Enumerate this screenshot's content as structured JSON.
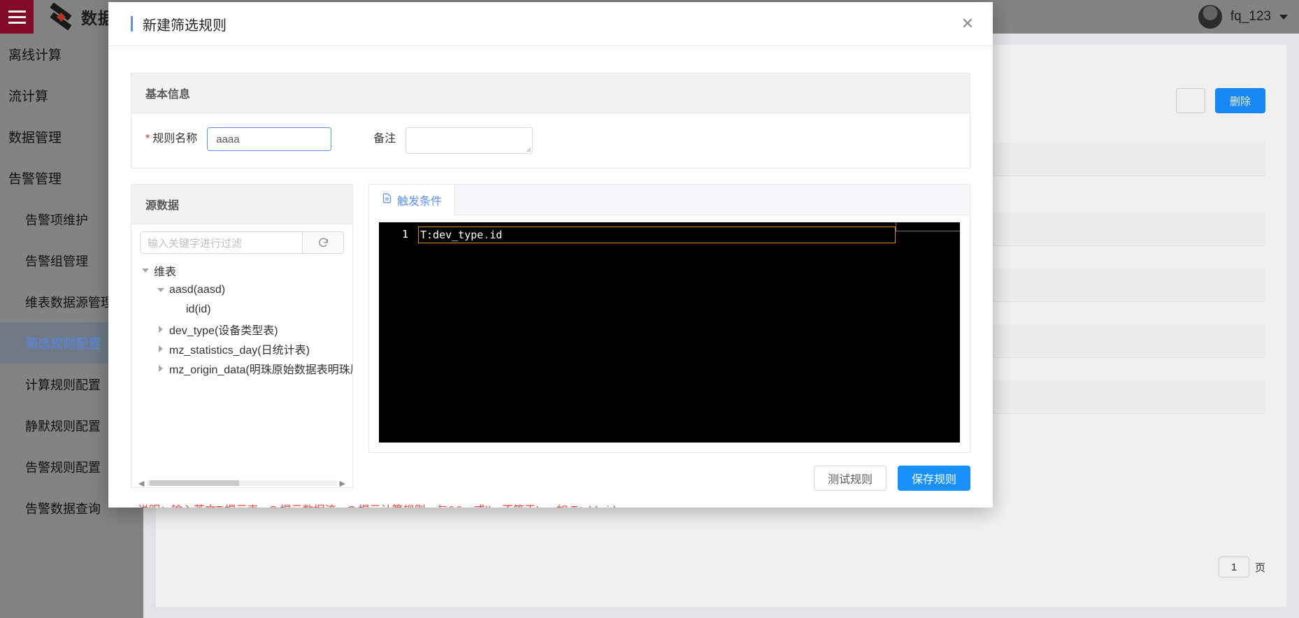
{
  "topbar": {
    "menu_icon": "hamburger-icon",
    "logo_icon": "brand-logo-icon",
    "brand_title": "数据中台",
    "user_name": "fq_123",
    "caret_icon": "chevron-down-icon"
  },
  "sidebar": {
    "items": [
      {
        "label": "离线计算",
        "sub": false,
        "active": false
      },
      {
        "label": "流计算",
        "sub": false,
        "active": false
      },
      {
        "label": "数据管理",
        "sub": false,
        "active": false
      },
      {
        "label": "告警管理",
        "sub": false,
        "active": false
      },
      {
        "label": "告警项维护",
        "sub": true,
        "active": false
      },
      {
        "label": "告警组管理",
        "sub": true,
        "active": false
      },
      {
        "label": "维表数据源管理",
        "sub": true,
        "active": false
      },
      {
        "label": "筛选规则配置",
        "sub": true,
        "active": true
      },
      {
        "label": "计算规则配置",
        "sub": true,
        "active": false
      },
      {
        "label": "静默规则配置",
        "sub": true,
        "active": false
      },
      {
        "label": "告警规则配置",
        "sub": true,
        "active": false
      },
      {
        "label": "告警数据查询",
        "sub": true,
        "active": false
      }
    ]
  },
  "background_page": {
    "delete_button": "删除",
    "pager_value": "1",
    "pager_unit": "页"
  },
  "modal": {
    "title": "新建筛选规则",
    "close_icon": "close-icon",
    "basic": {
      "header": "基本信息",
      "name_label": "规则名称",
      "name_required_mark": "*",
      "name_value": "aaaa",
      "remark_label": "备注",
      "remark_value": ""
    },
    "source": {
      "header": "源数据",
      "search_placeholder": "输入关键字进行过滤",
      "refresh_icon": "refresh-icon",
      "tree": [
        {
          "label": "维表",
          "depth": 0,
          "arrow": "down"
        },
        {
          "label": "aasd(aasd)",
          "depth": 1,
          "arrow": "down"
        },
        {
          "label": "id(id)",
          "depth": 2,
          "arrow": "none"
        },
        {
          "label": "dev_type(设备类型表)",
          "depth": 1,
          "arrow": "right"
        },
        {
          "label": "mz_statistics_day(日统计表)",
          "depth": 1,
          "arrow": "right"
        },
        {
          "label": "mz_origin_data(明珠原始数据表明珠原始",
          "depth": 1,
          "arrow": "right"
        }
      ],
      "scroll_left_icon": "chevron-left-icon",
      "scroll_right_icon": "chevron-right-icon"
    },
    "editor": {
      "tab_label": "触发条件",
      "tab_icon": "document-icon",
      "line_number": "1",
      "code_prefix": "T:dev_type",
      "code_dot": ".",
      "code_suffix": "id"
    },
    "actions": {
      "test_label": "测试规则",
      "save_label": "保存规则"
    },
    "hint": "说明：输入英文T:提示表，S:提示数据流，C:提示计算规则，与&&，或||，不等于!=。如 T:table.id"
  },
  "colors": {
    "accent": "#1890ff",
    "title_bar": "#5b8ff9",
    "hint_red": "#e8453c",
    "logo_red": "#8b0d2b",
    "sidebar_bg": "#8c8c8c",
    "editor_bg": "#000000",
    "code_box_border": "#d98c3c"
  }
}
